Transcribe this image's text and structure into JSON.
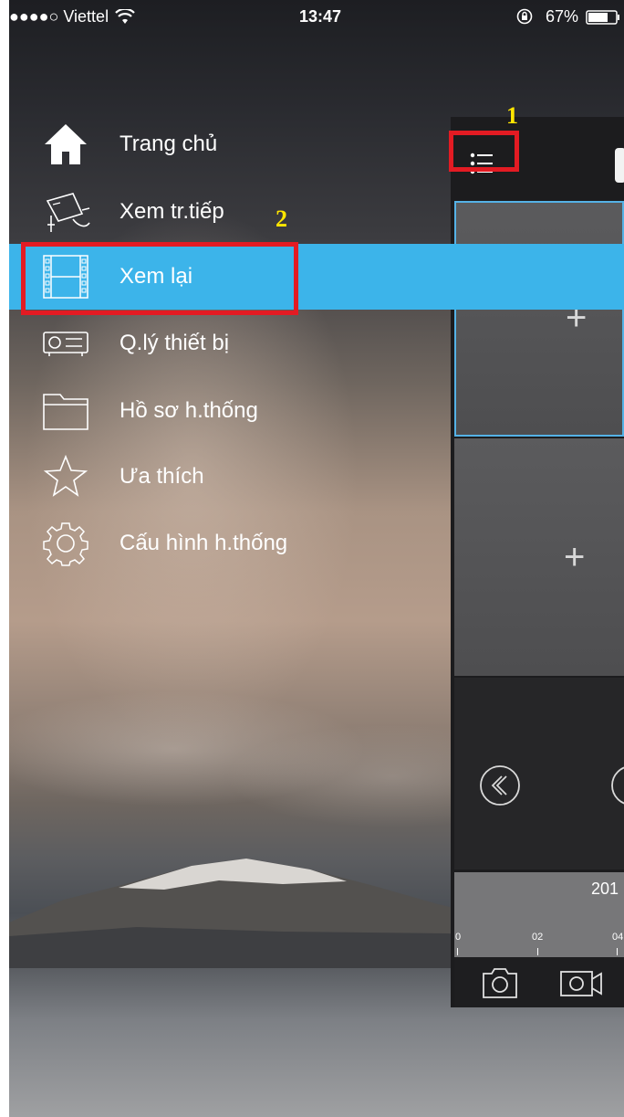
{
  "status_bar": {
    "carrier": "●●●●○ Viettel",
    "time": "13:47",
    "battery": "67%"
  },
  "menu": {
    "items": [
      {
        "label": "Trang chủ",
        "icon": "home-icon"
      },
      {
        "label": "Xem tr.tiếp",
        "icon": "cctv-camera-icon"
      },
      {
        "label": "Xem lại",
        "icon": "film-strip-icon",
        "selected": true
      },
      {
        "label": "Q.lý thiết bị",
        "icon": "dvr-device-icon"
      },
      {
        "label": "Hồ sơ h.thống",
        "icon": "folder-icon"
      },
      {
        "label": "Ưa thích",
        "icon": "star-icon"
      },
      {
        "label": "Cấu hình h.thống",
        "icon": "gear-icon"
      }
    ],
    "selected_color": "#3cb4ea"
  },
  "annotations": [
    {
      "number": "1",
      "color": "#ffe600",
      "box_color": "#e31b23"
    },
    {
      "number": "2",
      "color": "#ffe600",
      "box_color": "#e31b23"
    }
  ],
  "playback": {
    "date_partial": "201",
    "timeline_ticks": [
      "0",
      "02",
      "04"
    ]
  }
}
